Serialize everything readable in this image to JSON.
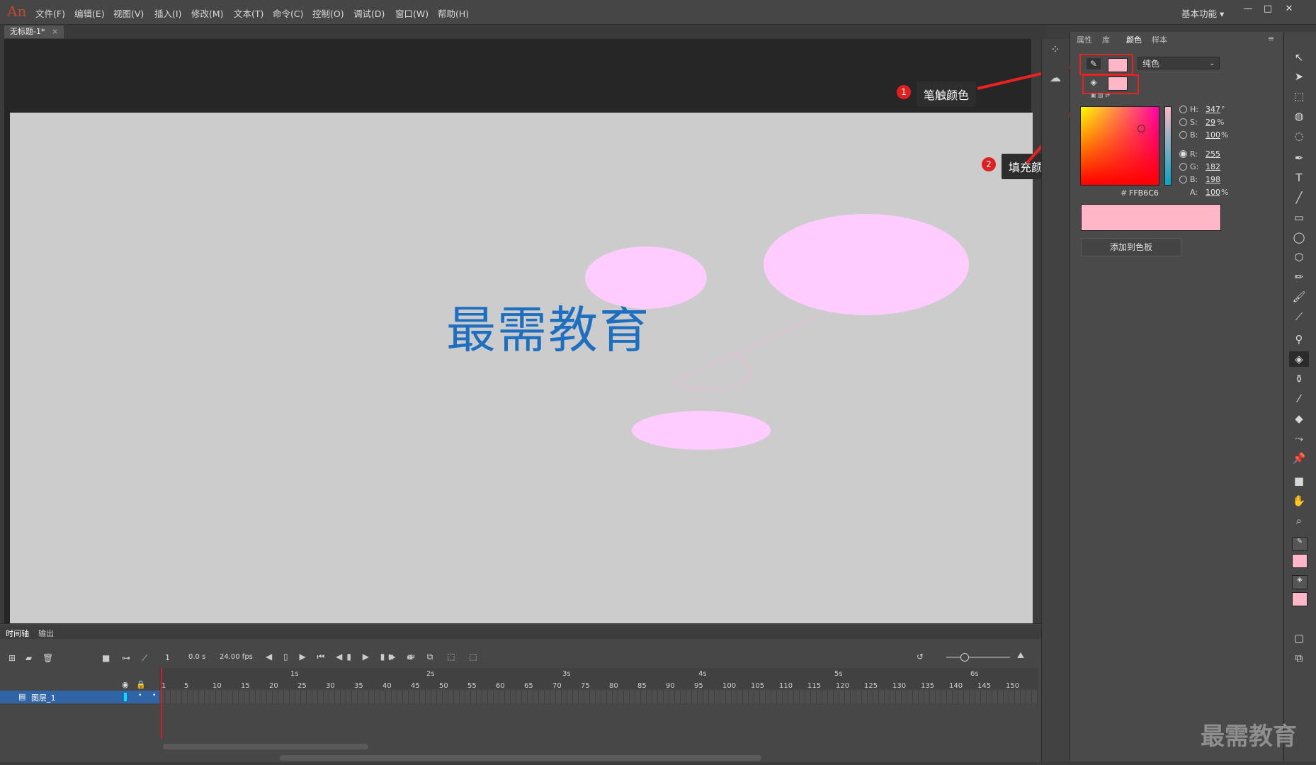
{
  "app": {
    "logo": "An",
    "workspace": "基本功能 ▾",
    "document_tab": "无标题-1*"
  },
  "menu": [
    "文件(F)",
    "编辑(E)",
    "视图(V)",
    "插入(I)",
    "修改(M)",
    "文本(T)",
    "命令(C)",
    "控制(O)",
    "调试(D)",
    "窗口(W)",
    "帮助(H)"
  ],
  "stage": {
    "text": "最需教育",
    "shape_fill": "#ffccff",
    "background": "#cccccc"
  },
  "annotations": {
    "stroke": {
      "badge": "1",
      "label": "笔触颜色"
    },
    "fill": {
      "badge": "2",
      "label": "填充颜色"
    }
  },
  "panel": {
    "tabs": [
      "属性",
      "库",
      "颜色",
      "样本"
    ],
    "active_tab": "颜色",
    "color_type": "纯色",
    "stroke_color": "#ffb6c6",
    "fill_color": "#ffb6c6",
    "hsb": {
      "h_label": "H:",
      "h": "347",
      "h_unit": "°",
      "s_label": "S:",
      "s": "29",
      "s_unit": "%",
      "b_label": "B:",
      "b": "100",
      "b_unit": "%"
    },
    "rgb": {
      "r_label": "R:",
      "r": "255",
      "g_label": "G:",
      "g": "182",
      "b_label": "B:",
      "b": "198"
    },
    "hex_label": "#",
    "hex": "FFB6C6",
    "alpha_label": "A:",
    "alpha": "100",
    "alpha_unit": "%",
    "add_swatch": "添加到色板"
  },
  "timeline": {
    "tabs": [
      "时间轴",
      "输出"
    ],
    "frame": "1",
    "time": "0.0 s",
    "fps": "24.00 fps",
    "layer_name": "图层_1",
    "seconds": [
      "1s",
      "2s",
      "3s",
      "4s",
      "5s",
      "6s"
    ],
    "frame_numbers": [
      "1",
      "5",
      "10",
      "15",
      "20",
      "25",
      "30",
      "35",
      "40",
      "45",
      "50",
      "55",
      "60",
      "65",
      "70",
      "75",
      "80",
      "85",
      "90",
      "95",
      "100",
      "105",
      "110",
      "115",
      "120",
      "125",
      "130",
      "135",
      "140",
      "145",
      "150"
    ]
  },
  "watermark": "最需教育",
  "icons": [
    "arrow-icon",
    "subselect-icon",
    "free-transform-icon",
    "3d-rotate-icon",
    "lasso-icon",
    "pen-icon",
    "text-icon",
    "line-icon",
    "rectangle-icon",
    "oval-icon",
    "polystar-icon",
    "pencil-icon",
    "paint-brush-icon",
    "brush-icon",
    "bone-icon",
    "paint-bucket-icon",
    "ink-bottle-icon",
    "eyedropper-icon",
    "eraser-icon",
    "width-icon",
    "pin-icon",
    "camera-icon",
    "hand-icon",
    "zoom-icon"
  ]
}
